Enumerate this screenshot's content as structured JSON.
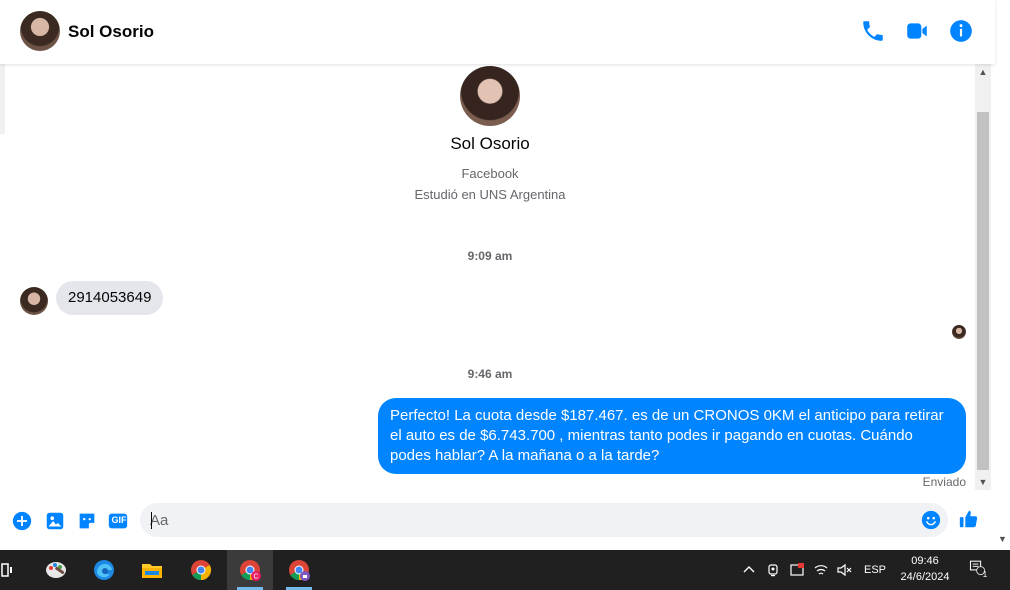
{
  "header": {
    "contact_name": "Sol Osorio",
    "icons": [
      "phone-icon",
      "video-camera-icon",
      "info-icon"
    ],
    "accent": "#0084ff"
  },
  "profile": {
    "name": "Sol Osorio",
    "line1": "Facebook",
    "line2": "Estudió en UNS Argentina"
  },
  "conversation": {
    "timestamp1": "9:09 am",
    "incoming_message": "2914053649",
    "timestamp2": "9:46 am",
    "outgoing_message": "Perfecto! La cuota desde $187.467. es de un CRONOS 0KM el anticipo para retirar el auto es de $6.743.700 , mientras tanto podes ir pagando en cuotas. Cuándo podes hablar? A la mañana o a la tarde?",
    "status": "Enviado",
    "bubble_color": "#0084ff"
  },
  "composer": {
    "placeholder": "Aa",
    "gif_label": "GIF",
    "icons": [
      "plus-icon",
      "image-icon",
      "sticker-icon",
      "gif-icon",
      "emoji-icon",
      "thumbs-up-icon"
    ]
  },
  "taskbar": {
    "apps": [
      "task-view-icon",
      "paint-icon",
      "edge-icon",
      "file-explorer-icon",
      "chrome-icon",
      "chrome-profile-icon",
      "chrome-secondary-icon"
    ],
    "language": "ESP",
    "time": "09:46",
    "date": "24/6/2024",
    "notification_count": "1"
  }
}
